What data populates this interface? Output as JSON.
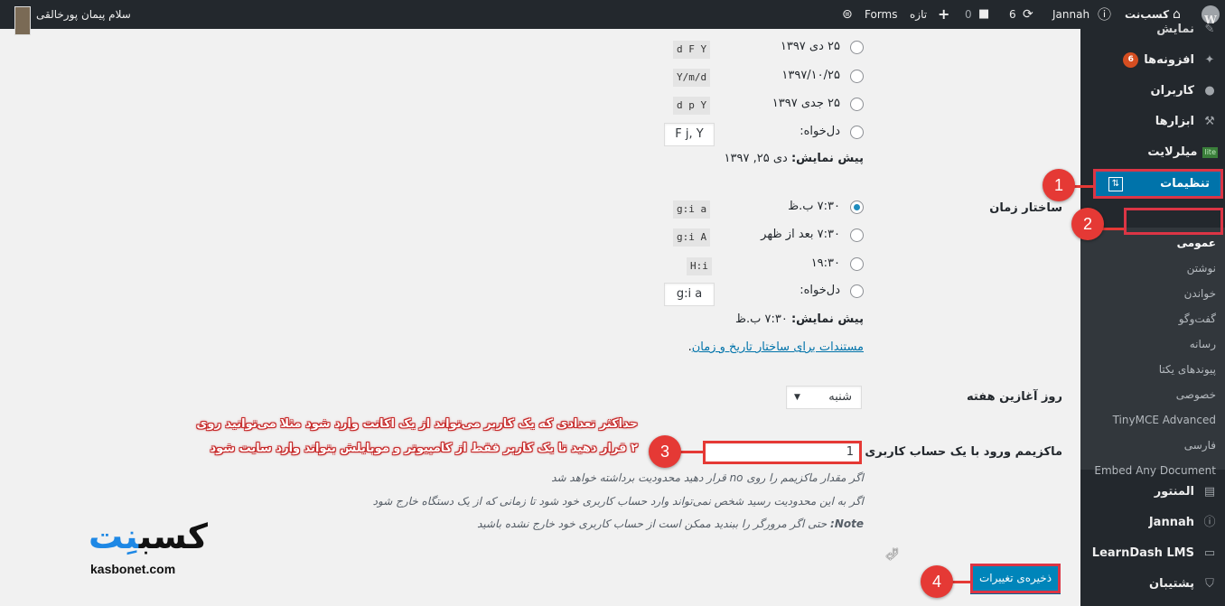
{
  "admin_bar": {
    "greeting": "سلام پیمان پورخالقی",
    "site_name": "کسب‌نت",
    "theme": "Jannah",
    "updates_count": "6",
    "comments_count": "0",
    "new_label": "تازه",
    "forms_label": "Forms"
  },
  "sidebar": {
    "items_top": [
      {
        "label": "نمایش",
        "icon": "brush-icon"
      },
      {
        "label": "افزونه‌ها",
        "icon": "plugin-icon",
        "badge": "6"
      },
      {
        "label": "کاربران",
        "icon": "user-icon"
      },
      {
        "label": "ابزارها",
        "icon": "wrench-icon"
      },
      {
        "label": "میلرلایت",
        "icon": "mailerlite-icon",
        "tag": "lite"
      }
    ],
    "active_item": {
      "label": "تنظیمات",
      "icon": "settings-icon"
    },
    "submenu": [
      "عمومی",
      "نوشتن",
      "خواندن",
      "گفت‌وگو",
      "رسانه",
      "پیوندهای یکتا",
      "خصوصی",
      "TinyMCE Advanced",
      "فارسی",
      "Embed Any Document"
    ],
    "items_bottom": [
      {
        "label": "المنتور",
        "icon": "elementor-icon"
      },
      {
        "label": "Jannah",
        "icon": "info-icon"
      },
      {
        "label": "LearnDash LMS",
        "icon": "monitor-icon"
      },
      {
        "label": "پشتیبان",
        "icon": "shield-icon"
      }
    ]
  },
  "date_format": {
    "options": [
      {
        "label": "۲۵ دی ۱۳۹۷",
        "code": "d F Y"
      },
      {
        "label": "۱۳۹۷/۱۰/۲۵",
        "code": "Y/m/d"
      },
      {
        "label": "۲۵ جدی ۱۳۹۷",
        "code": "d p Y"
      }
    ],
    "custom_label": "دل‌خواه:",
    "custom_value": "F j, Y",
    "preview_label": "پیش نمایش:",
    "preview_value": "دی ۲۵, ۱۳۹۷"
  },
  "time_format": {
    "label": "ساختار زمان",
    "options": [
      {
        "label": "۷:۳۰ ب.ظ",
        "code": "g:i a",
        "checked": true
      },
      {
        "label": "۷:۳۰ بعد از ظهر",
        "code": "g:i A",
        "checked": false
      },
      {
        "label": "۱۹:۳۰",
        "code": "H:i",
        "checked": false
      }
    ],
    "custom_label": "دل‌خواه:",
    "custom_value": "g:i a",
    "preview_label": "پیش نمایش:",
    "preview_value": "۷:۳۰ ب.ظ",
    "docs_link": "مستندات برای ساختار تاریخ و زمان",
    "docs_suffix": "."
  },
  "week_start": {
    "label": "روز آغازین هفته",
    "value": "شنبه"
  },
  "max_login": {
    "label": "ماکزیمم ورود با یک حساب کاربری",
    "value": "1",
    "descriptions": [
      "اگر مقدار ماکزیمم را روی no قرار دهید محدودیت برداشته خواهد شد",
      "اگر به این محدودیت رسید شخص نمی‌تواند وارد حساب کاربری خود شود تا زمانی که از یک دستگاه خارج شود"
    ],
    "note_label": "Note:",
    "note_text": "حتی اگر مرورگر را ببندید ممکن است از حساب کاربری خود خارج نشده باشید"
  },
  "annotation": {
    "line1": "حداکثر تعدادی که یک کاربر می‌تواند از یک اکانت وارد شود مثلا می‌توانید روی",
    "line2": "۲ قرار دهید تا یک کاربر فقط از کامپیوتر و موبایلش بتواند وارد سایت شود"
  },
  "callouts": [
    "1",
    "2",
    "3",
    "4"
  ],
  "save_button": "ذخیره‌ی تغییرات",
  "logo": {
    "fa_main": "کسب",
    "fa_accent": "نِت",
    "en": "kasbonet.com"
  },
  "colors": {
    "admin_bar": "#23282d",
    "accent": "#0073aa",
    "callout": "#e53935",
    "annotation": "#c62828"
  }
}
